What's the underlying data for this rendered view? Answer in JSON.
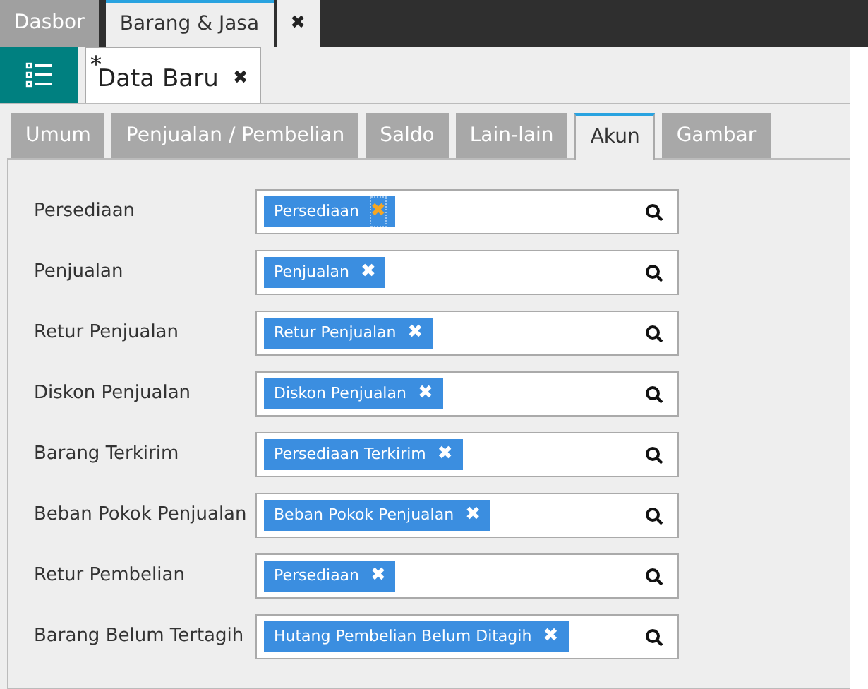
{
  "top_tabs": [
    {
      "label": "Dasbor",
      "selected": false
    },
    {
      "label": "Barang & Jasa",
      "selected": true
    }
  ],
  "top_close": "✖",
  "doc_tab": {
    "modified_mark": "*",
    "title": "Data Baru",
    "close": "✖"
  },
  "section_tabs": [
    {
      "label": "Umum",
      "selected": false
    },
    {
      "label": "Penjualan / Pembelian",
      "selected": false
    },
    {
      "label": "Saldo",
      "selected": false
    },
    {
      "label": "Lain-lain",
      "selected": false
    },
    {
      "label": "Akun",
      "selected": true
    },
    {
      "label": "Gambar",
      "selected": false
    }
  ],
  "fields": [
    {
      "label": "Persediaan",
      "value": "Persediaan",
      "remove": "✖",
      "focused": true
    },
    {
      "label": "Penjualan",
      "value": "Penjualan",
      "remove": "✖",
      "focused": false
    },
    {
      "label": "Retur Penjualan",
      "value": "Retur Penjualan",
      "remove": "✖",
      "focused": false
    },
    {
      "label": "Diskon Penjualan",
      "value": "Diskon Penjualan",
      "remove": "✖",
      "focused": false
    },
    {
      "label": "Barang Terkirim",
      "value": "Persediaan Terkirim",
      "remove": "✖",
      "focused": false
    },
    {
      "label": "Beban Pokok Penjualan",
      "value": "Beban Pokok Penjualan",
      "remove": "✖",
      "focused": false
    },
    {
      "label": "Retur Pembelian",
      "value": "Persediaan",
      "remove": "✖",
      "focused": false
    },
    {
      "label": "Barang Belum Tertagih",
      "value": "Hutang Pembelian Belum Ditagih",
      "remove": "✖",
      "focused": false
    }
  ]
}
